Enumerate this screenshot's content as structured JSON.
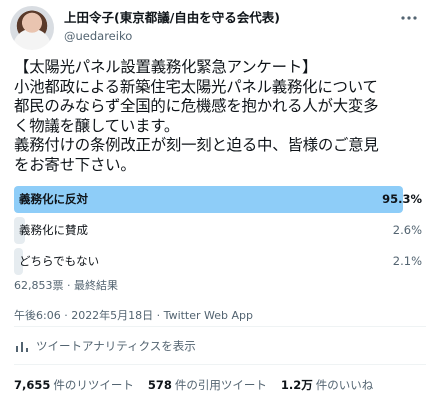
{
  "author": {
    "display_name": "上田令子(東京都議/自由を守る会代表)",
    "handle": "@uedareiko"
  },
  "tweet": {
    "text": "【太陽光パネル設置義務化緊急アンケート】\n小池都政による新築住宅太陽光パネル義務化について\n都民のみならず全国的に危機感を抱かれる人が大変多\nく物議を醸しています。\n義務付けの条例改正が刻一刻と迫る中、皆様のご意見\nをお寄せ下さい。"
  },
  "poll": {
    "options": [
      {
        "label": "義務化に反対",
        "percent_text": "95.3%",
        "percent": 95.3,
        "winner": true
      },
      {
        "label": "義務化に賛成",
        "percent_text": "2.6%",
        "percent": 2.6,
        "winner": false
      },
      {
        "label": "どちらでもない",
        "percent_text": "2.1%",
        "percent": 2.1,
        "winner": false
      }
    ],
    "meta": "62,853票 · 最終結果"
  },
  "timestamp": "午後6:06 · 2022年5月18日 · Twitter Web App",
  "analytics_label": "ツイートアナリティクスを表示",
  "stats": {
    "retweets_count": "7,655",
    "retweets_label": "件のリツイート",
    "quotes_count": "578",
    "quotes_label": "件の引用ツイート",
    "likes_count": "1.2万",
    "likes_label": "件のいいね"
  },
  "icons": {
    "more": "more-icon",
    "analytics": "analytics-icon"
  },
  "colors": {
    "winner_bar": "#8ecdf8",
    "other_bar": "#e6ecf0",
    "secondary_text": "#536471"
  }
}
